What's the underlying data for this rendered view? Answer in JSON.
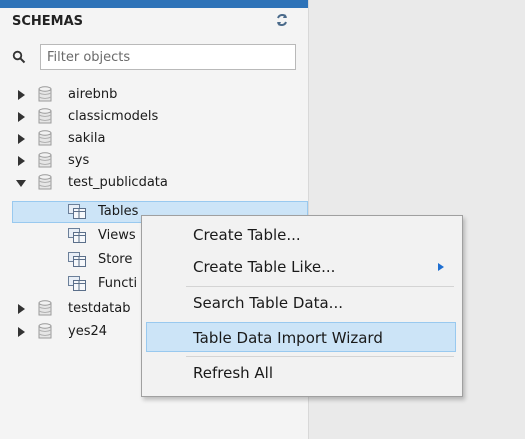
{
  "header": {
    "title": "SCHEMAS"
  },
  "filter": {
    "placeholder": "Filter objects"
  },
  "tree": {
    "schemas": [
      "airebnb",
      "classicmodels",
      "sakila",
      "sys",
      "test_publicdata",
      "testdatab",
      "yes24"
    ],
    "children": [
      "Tables",
      "Views",
      "Store",
      "Functi"
    ]
  },
  "context_menu": {
    "items": [
      "Create Table...",
      "Create Table Like...",
      "Search Table Data...",
      "Table Data Import Wizard",
      "Refresh All"
    ],
    "highlighted": "Table Data Import Wizard"
  },
  "colors": {
    "accent": "#2e73b8",
    "highlight": "#cce4f7",
    "submenu_arrow": "#1f6fd1"
  }
}
